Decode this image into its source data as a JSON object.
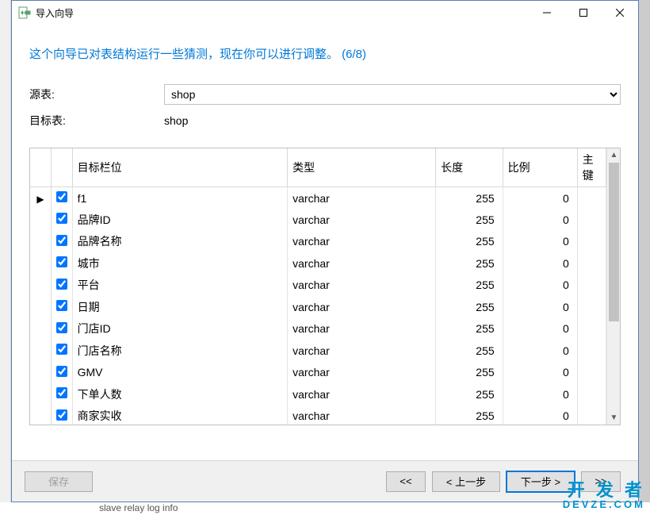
{
  "window": {
    "title": "导入向导"
  },
  "subheader": "这个向导已对表结构运行一些猜测，现在你可以进行调整。 (6/8)",
  "form": {
    "source_label": "源表:",
    "source_value": "shop",
    "target_label": "目标表:",
    "target_value": "shop"
  },
  "columns": {
    "target_field": "目标栏位",
    "type": "类型",
    "length": "长度",
    "scale": "比例",
    "pk": "主键"
  },
  "rows": [
    {
      "checked": true,
      "current": true,
      "name": "f1",
      "type": "varchar",
      "length": 255,
      "scale": 0
    },
    {
      "checked": true,
      "current": false,
      "name": "品牌ID",
      "type": "varchar",
      "length": 255,
      "scale": 0
    },
    {
      "checked": true,
      "current": false,
      "name": "品牌名称",
      "type": "varchar",
      "length": 255,
      "scale": 0
    },
    {
      "checked": true,
      "current": false,
      "name": "城市",
      "type": "varchar",
      "length": 255,
      "scale": 0
    },
    {
      "checked": true,
      "current": false,
      "name": "平台",
      "type": "varchar",
      "length": 255,
      "scale": 0
    },
    {
      "checked": true,
      "current": false,
      "name": "日期",
      "type": "varchar",
      "length": 255,
      "scale": 0
    },
    {
      "checked": true,
      "current": false,
      "name": "门店ID",
      "type": "varchar",
      "length": 255,
      "scale": 0
    },
    {
      "checked": true,
      "current": false,
      "name": "门店名称",
      "type": "varchar",
      "length": 255,
      "scale": 0
    },
    {
      "checked": true,
      "current": false,
      "name": "GMV",
      "type": "varchar",
      "length": 255,
      "scale": 0
    },
    {
      "checked": true,
      "current": false,
      "name": "下单人数",
      "type": "varchar",
      "length": 255,
      "scale": 0
    },
    {
      "checked": true,
      "current": false,
      "name": "商家实收",
      "type": "varchar",
      "length": 255,
      "scale": 0
    }
  ],
  "buttons": {
    "save": "保存",
    "first": "<<",
    "back": "< 上一步",
    "next": "下一步 >",
    "last": ">>"
  },
  "backdrop_text": "slave relay log info",
  "watermark": {
    "line1": "开 发 者",
    "line2": "DEVZE.COM"
  }
}
